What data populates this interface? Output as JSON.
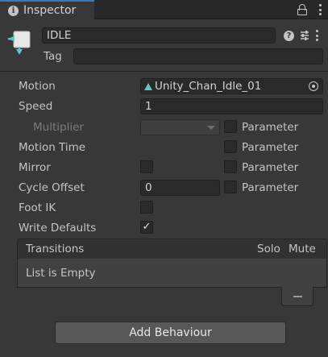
{
  "window": {
    "tab_title": "Inspector",
    "tab_icon": "info-icon"
  },
  "header": {
    "state_name": "IDLE",
    "tag_label": "Tag",
    "tag_value": "",
    "help_glyph": "?"
  },
  "properties": {
    "motion_label": "Motion",
    "motion_value": "Unity_Chan_Idle_01",
    "speed_label": "Speed",
    "speed_value": "1",
    "multiplier_label": "Multiplier",
    "multiplier_parameter_label": "Parameter",
    "motion_time_label": "Motion Time",
    "motion_time_parameter_label": "Parameter",
    "mirror_label": "Mirror",
    "mirror_checked": false,
    "mirror_parameter_label": "Parameter",
    "cycle_offset_label": "Cycle Offset",
    "cycle_offset_value": "0",
    "cycle_offset_parameter_label": "Parameter",
    "foot_ik_label": "Foot IK",
    "foot_ik_checked": false,
    "write_defaults_label": "Write Defaults",
    "write_defaults_checked": true,
    "check_glyph": "✓"
  },
  "transitions": {
    "title": "Transitions",
    "solo_label": "Solo",
    "mute_label": "Mute",
    "empty_text": "List is Empty"
  },
  "footer": {
    "add_behaviour_label": "Add Behaviour"
  },
  "colors": {
    "background": "#383838",
    "tab_accent": "#3a79bb",
    "animation_clip_icon": "#5ac8c8"
  }
}
